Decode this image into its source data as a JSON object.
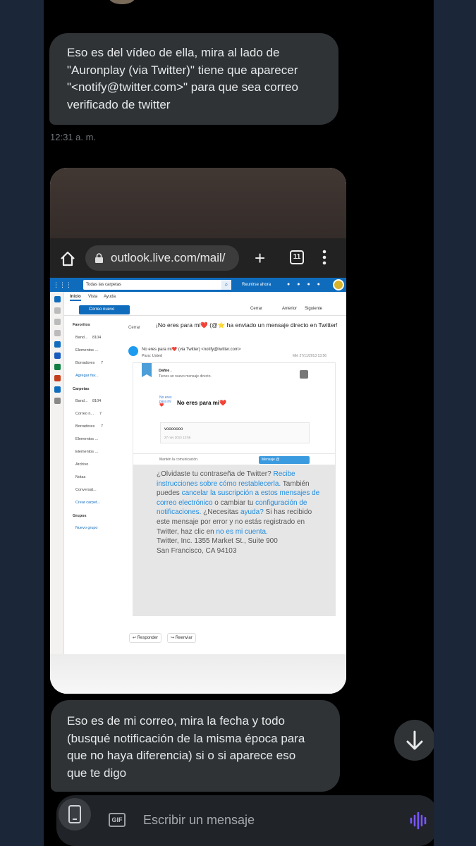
{
  "messages": {
    "first": {
      "line1": "Eso es del vídeo de ella, mira al lado de",
      "line2": "\"Auronplay (via Twitter)\" tiene que aparecer",
      "line3": "\"<notify@twitter.com>\" para que sea correo",
      "line4": "verificado de twitter",
      "time": "12:31 a. m."
    },
    "second": {
      "line1": "Eso es de mi correo, mira la fecha y todo",
      "line2": "(busqué notificación de la misma época para",
      "line3": "que no haya diferencia) si o si aparece eso",
      "line4": "que te digo"
    }
  },
  "browser": {
    "url": "outlook.live.com/mail/",
    "tab_count": "11"
  },
  "outlook": {
    "search_placeholder": "Todas las carpetas",
    "meet_now": "Reunirse ahora",
    "menu": [
      "Inicio",
      "Vista",
      "Ayuda"
    ],
    "new_mail": "Correo nuevo",
    "cmd_close": "Cerrar",
    "cmd_prev": "Anterior",
    "cmd_next": "Siguiente",
    "folders": {
      "favorites": "Favoritos",
      "inbox": "Band...",
      "inbox_count": "8104",
      "sent": "Elementos ...",
      "drafts": "Borradores",
      "drafts_count": "7",
      "add_fav": "Agregar fav...",
      "folders_head": "Carpetas",
      "inbox2": "Band...",
      "inbox2_count": "8104",
      "junk": "Correo n...",
      "junk_count": "7",
      "drafts2": "Borradores",
      "drafts2_count": "7",
      "sent2": "Elementos ...",
      "deleted": "Elementos ...",
      "archive": "Archivo",
      "notes": "Notas",
      "conversation": "Conversat...",
      "create_folder": "Crear carpet...",
      "groups_head": "Grupos",
      "new_group": "Nuevo grupo"
    },
    "email": {
      "close": "Cerrar",
      "subject": "¡No eres para mi❤️ (@⭐ ha enviado un mensaje directo en Twitter!",
      "sender": "No eres para mi❤️ (via Twitter) <notify@twitter.com>",
      "to": "Para: Usted",
      "date": "Mié 27/11/2013 13:56",
      "card_sender": "Dafne .",
      "card_sub": "Tienes un nuevo mensaje directo.",
      "img_alt": "No eres para mi❤️",
      "card_name": "No eres para mi❤️",
      "dm_text": "vooooooo",
      "dm_date": "27 nov 2013 12:56",
      "foot_text": "Mantén la comunicación.",
      "foot_btn": "Mensaje @",
      "footer": {
        "p1a": "¿Olvidaste tu contraseña de Twitter? ",
        "p1b": "Recibe instrucciones sobre cómo restablecerla.",
        "p2a": " También puedes ",
        "p2b": "cancelar la suscripción a estos mensajes de correo electrónico",
        "p2c": " o cambiar tu ",
        "p2d": "configuración de notificaciones.",
        "p3a": " ¿Necesitas ",
        "p3b": "ayuda?",
        "p4a": " Si has recibido este mensaje por error y no estás registrado en Twitter, haz clic en ",
        "p4b": "no es mi cuenta.",
        "addr1": "Twitter, Inc. 1355 Market St., Suite 900",
        "addr2": "San Francisco, CA 94103"
      }
    },
    "reply": "Responder",
    "forward": "Reenviar"
  },
  "composer": {
    "placeholder": "Escribir un mensaje",
    "gif": "GIF"
  },
  "colors": {
    "bubble": "#2f3336",
    "outlook_blue": "#0f6cbd",
    "link": "#1d8be0",
    "voice": "#7856ff"
  }
}
